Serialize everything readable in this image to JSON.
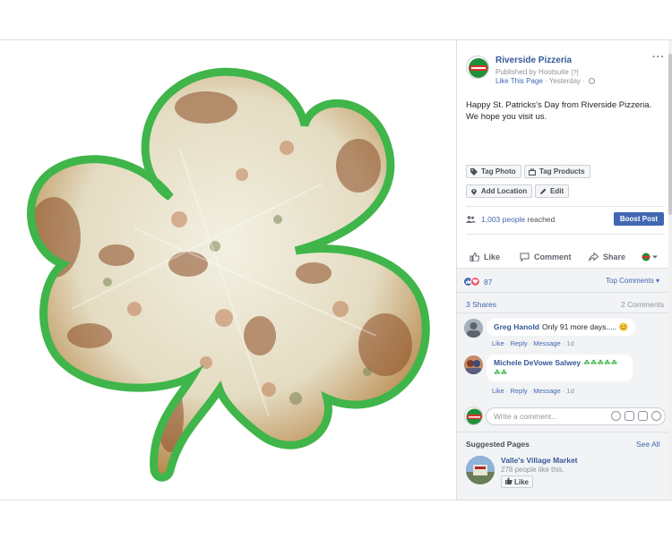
{
  "post": {
    "page_name": "Riverside Pizzeria",
    "published_by": "Published by Hootsuite",
    "published_help": "[?]",
    "like_page": "Like This Page",
    "time": "Yesterday",
    "dot": "·",
    "more": "···",
    "text_line1": "Happy St. Patricks's Day from Riverside Pizzeria.",
    "text_line2": "We hope you visit us.",
    "photo_icon": "shamrock-shaped-pizza-photo"
  },
  "tools": {
    "tag_photo": "Tag Photo",
    "tag_products": "Tag Products",
    "add_location": "Add Location",
    "edit": "Edit"
  },
  "reach": {
    "count": "1,003 people",
    "suffix": " reached",
    "boost": "Boost Post"
  },
  "actions": {
    "like": "Like",
    "comment": "Comment",
    "share": "Share"
  },
  "stats": {
    "reaction_count": "87",
    "top_comments": "Top Comments ▾",
    "shares": "3 Shares",
    "comment_count": "2 Comments"
  },
  "comments": [
    {
      "author": "Greg Hanold",
      "text": "Only 91 more days.....",
      "emoji": "😊",
      "like": "Like",
      "reply": "Reply",
      "message": "Message",
      "time": "1d",
      "sep": " · "
    },
    {
      "author": "Michele DeVowe Salwey",
      "text_line1": "☘☘☘☘☘",
      "text_line2": "☘☘",
      "like": "Like",
      "reply": "Reply",
      "message": "Message",
      "time": "1d",
      "sep": " · "
    }
  ],
  "composer": {
    "placeholder": "Write a comment..."
  },
  "suggested": {
    "header": "Suggested Pages",
    "see_all": "See All",
    "page_name": "Valle's Village Market",
    "likes": "278 people like this.",
    "like_button": "Like"
  },
  "colors": {
    "facebook_blue": "#4267b2",
    "link_blue": "#365899",
    "shamrock_green": "#3fb54a",
    "panel_gray": "#f2f3f5"
  }
}
